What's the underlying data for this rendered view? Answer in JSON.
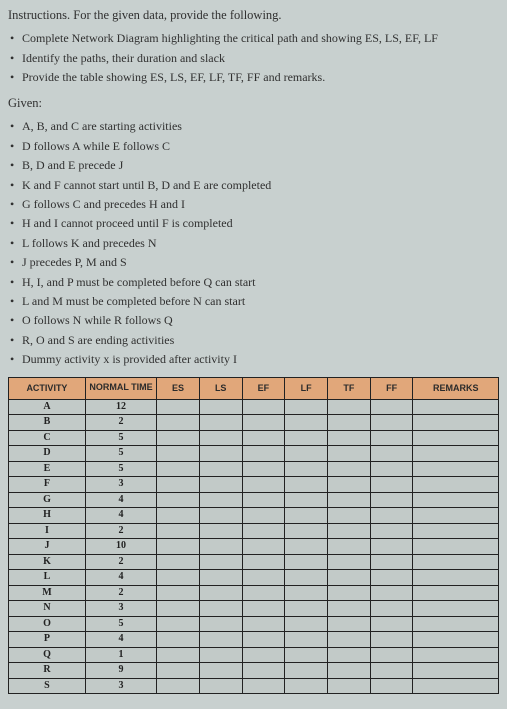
{
  "instructions_head": "Instructions. For the given data, provide the following.",
  "requirements": [
    "Complete Network Diagram highlighting the critical path and showing ES, LS, EF, LF",
    "Identify the paths, their duration and slack",
    "Provide the table showing ES, LS, EF, LF, TF, FF and remarks."
  ],
  "given_label": "Given:",
  "given": [
    "A, B, and C are starting activities",
    "D follows A while E follows C",
    "B, D and E precede J",
    "K and F cannot start until B, D and E are completed",
    "G follows C and precedes H and I",
    "H and I cannot proceed until F is completed",
    "L follows K and precedes N",
    "J precedes P, M and S",
    "H, I, and P must be completed before Q can start",
    "L and M must be completed before N can start",
    "O follows N while R follows Q",
    "R, O and S are ending activities",
    "Dummy activity x is provided after activity I"
  ],
  "table": {
    "headers": {
      "activity": "ACTIVITY",
      "normal_time": "NORMAL TIME",
      "es": "ES",
      "ls": "LS",
      "ef": "EF",
      "lf": "LF",
      "tf": "TF",
      "ff": "FF",
      "remarks": "REMARKS"
    },
    "rows": [
      {
        "activity": "A",
        "normal_time": "12"
      },
      {
        "activity": "B",
        "normal_time": "2"
      },
      {
        "activity": "C",
        "normal_time": "5"
      },
      {
        "activity": "D",
        "normal_time": "5"
      },
      {
        "activity": "E",
        "normal_time": "5"
      },
      {
        "activity": "F",
        "normal_time": "3"
      },
      {
        "activity": "G",
        "normal_time": "4"
      },
      {
        "activity": "H",
        "normal_time": "4"
      },
      {
        "activity": "I",
        "normal_time": "2"
      },
      {
        "activity": "J",
        "normal_time": "10"
      },
      {
        "activity": "K",
        "normal_time": "2"
      },
      {
        "activity": "L",
        "normal_time": "4"
      },
      {
        "activity": "M",
        "normal_time": "2"
      },
      {
        "activity": "N",
        "normal_time": "3"
      },
      {
        "activity": "O",
        "normal_time": "5"
      },
      {
        "activity": "P",
        "normal_time": "4"
      },
      {
        "activity": "Q",
        "normal_time": "1"
      },
      {
        "activity": "R",
        "normal_time": "9"
      },
      {
        "activity": "S",
        "normal_time": "3"
      }
    ]
  },
  "chart_data": {
    "type": "table",
    "title": "Activity Normal Times",
    "columns": [
      "ACTIVITY",
      "NORMAL TIME",
      "ES",
      "LS",
      "EF",
      "LF",
      "TF",
      "FF",
      "REMARKS"
    ],
    "series": [
      {
        "name": "NORMAL TIME",
        "categories": [
          "A",
          "B",
          "C",
          "D",
          "E",
          "F",
          "G",
          "H",
          "I",
          "J",
          "K",
          "L",
          "M",
          "N",
          "O",
          "P",
          "Q",
          "R",
          "S"
        ],
        "values": [
          12,
          2,
          5,
          5,
          5,
          3,
          4,
          4,
          2,
          10,
          2,
          4,
          2,
          3,
          5,
          4,
          1,
          9,
          3
        ]
      }
    ]
  }
}
